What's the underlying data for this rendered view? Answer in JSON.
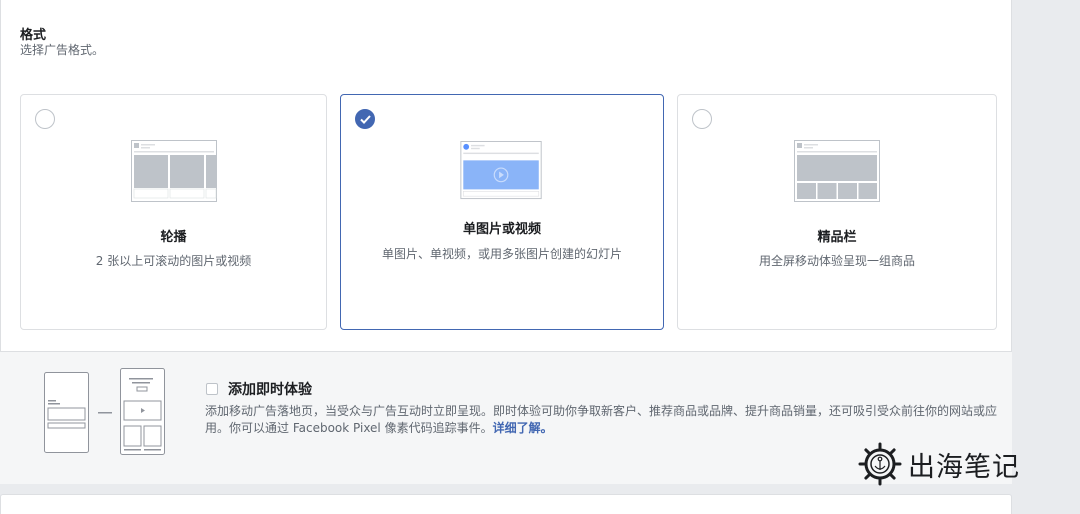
{
  "format": {
    "title": "格式",
    "subtitle": "选择广告格式。"
  },
  "cards": [
    {
      "title": "轮播",
      "desc": "2 张以上可滚动的图片或视频",
      "selected": false
    },
    {
      "title": "单图片或视频",
      "desc": "单图片、单视频，或用多张图片创建的幻灯片",
      "selected": true
    },
    {
      "title": "精品栏",
      "desc": "用全屏移动体验呈现一组商品",
      "selected": false
    }
  ],
  "instant_experience": {
    "title": "添加即时体验",
    "desc_before_link": "添加移动广告落地页，当受众与广告互动时立即呈现。即时体验可助你争取新客户、推荐商品或品牌、提升商品销量，还可吸引受众前往你的网站或应用。你可以通过 Facebook Pixel 像素代码追踪事件。",
    "link": "详细了解。",
    "checked": false
  },
  "watermark": {
    "text": "出海笔记"
  },
  "colors": {
    "accent": "#4267b2",
    "border": "#dddfe2",
    "muted_text": "#606770",
    "footer_bg": "#f5f6f7"
  }
}
